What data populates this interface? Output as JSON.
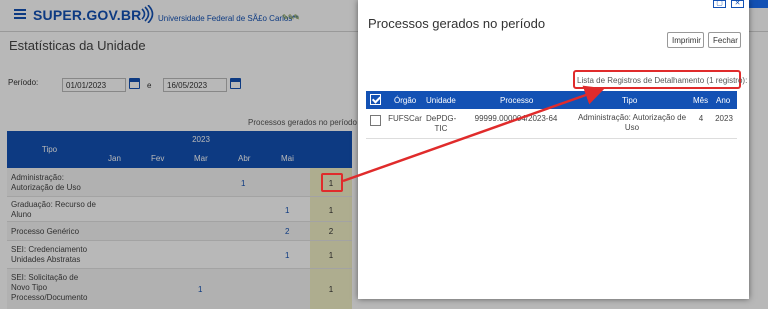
{
  "header": {
    "brand": "SUPER.GOV.BR",
    "university": "Universidade Federal de SÃ£o Carlos**"
  },
  "page": {
    "title": "Estatísticas da Unidade",
    "periodo_label": "Período:",
    "date_from": "01/01/2023",
    "date_to": "16/05/2023",
    "date_sep": "e",
    "processes_label": "Processos gerados no período"
  },
  "table": {
    "tipo_header": "Tipo",
    "year": "2023",
    "months": [
      "Jan",
      "Fev",
      "Mar",
      "Abr",
      "Mai"
    ],
    "rows": [
      {
        "tipo": "Administração: Autorização de Uso",
        "values": [
          "",
          "",
          "",
          "1",
          ""
        ],
        "total": "1"
      },
      {
        "tipo": "Graduação: Recurso de Aluno",
        "values": [
          "",
          "",
          "",
          "",
          "1"
        ],
        "total": "1"
      },
      {
        "tipo": "Processo Genérico",
        "values": [
          "",
          "",
          "",
          "",
          "2"
        ],
        "total": "2"
      },
      {
        "tipo": "SEI: Credenciamento Unidades Abstratas",
        "values": [
          "",
          "",
          "",
          "",
          "1"
        ],
        "total": "1"
      },
      {
        "tipo": "SEI: Solicitação de Novo Tipo Processo/Documento",
        "values": [
          "",
          "",
          "1",
          "",
          ""
        ],
        "total": "1"
      }
    ]
  },
  "modal": {
    "title": "Processos gerados no período",
    "print_button": "Imprimir",
    "close_button": "Fechar",
    "list_info": "Lista de Registros de Detalhamento (1 registro):",
    "columns": [
      "Órgão",
      "Unidade",
      "Processo",
      "Tipo",
      "Mês",
      "Ano"
    ],
    "rows": [
      {
        "orgao": "FUFSCar",
        "unidade": "DePDG-TIC",
        "processo": "99999.000004/2023-64",
        "tipo": "Administração: Autorização de Uso",
        "mes": "4",
        "ano": "2023"
      }
    ]
  },
  "colors": {
    "primary": "#1351b4",
    "highlight": "#e02b2b",
    "total_bg": "#f2f0c6"
  }
}
